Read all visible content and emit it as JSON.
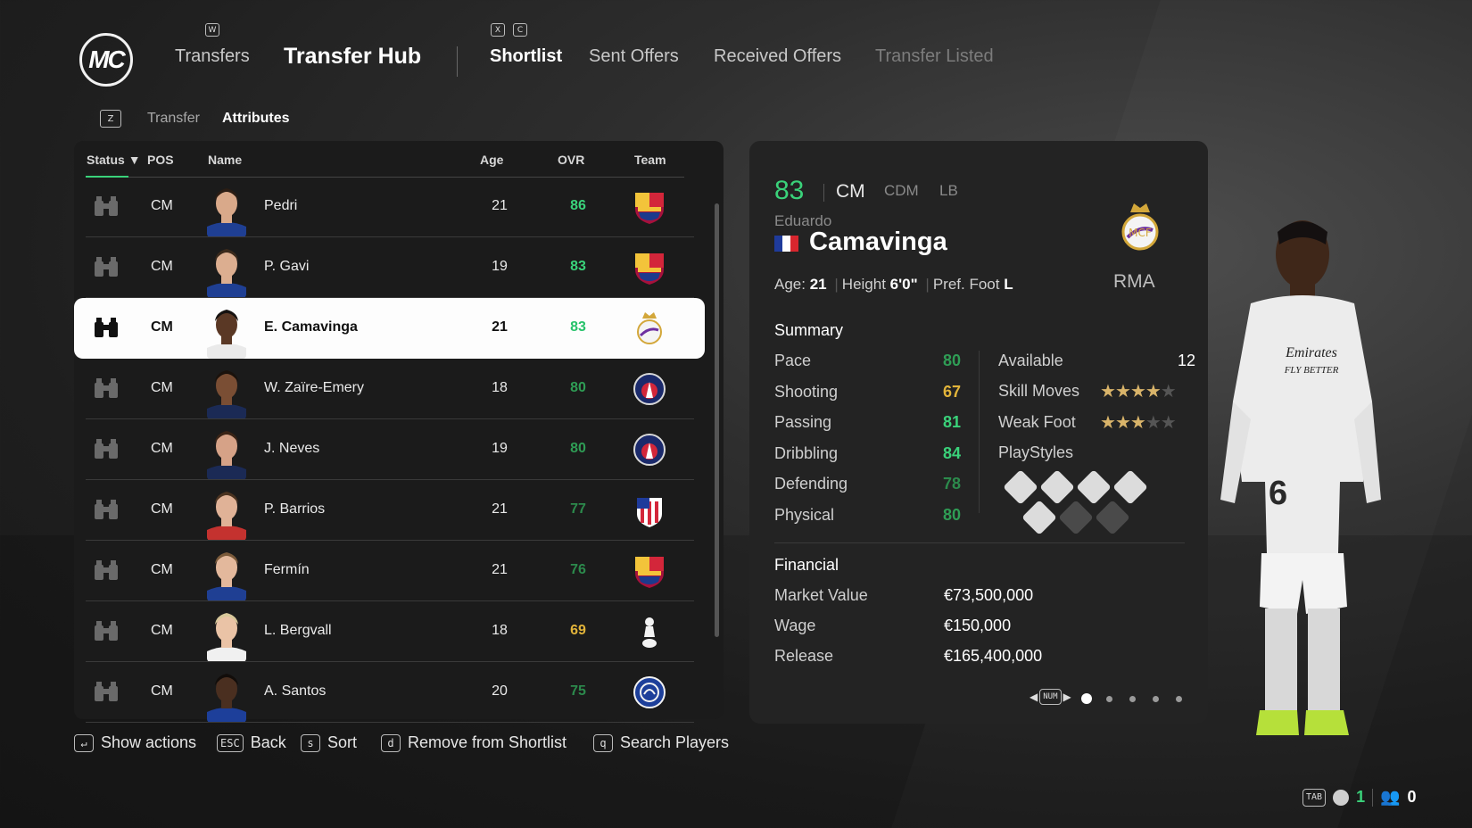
{
  "header": {
    "logo": "MC",
    "nav_transfers": "Transfers",
    "title": "Transfer Hub",
    "key_w": "W",
    "key_x": "X",
    "key_c": "C",
    "tabs": [
      {
        "label": "Shortlist",
        "state": "active"
      },
      {
        "label": "Sent Offers",
        "state": "normal"
      },
      {
        "label": "Received Offers",
        "state": "normal"
      },
      {
        "label": "Transfer Listed",
        "state": "disabled"
      }
    ]
  },
  "subnav": {
    "key": "Z",
    "items": [
      "Transfer",
      "Attributes"
    ],
    "active": "Attributes"
  },
  "table": {
    "columns": {
      "status": "Status",
      "pos": "POS",
      "name": "Name",
      "age": "Age",
      "ovr": "OVR",
      "team": "Team"
    },
    "sort_indicator": "▼",
    "rows": [
      {
        "pos": "CM",
        "name": "Pedri",
        "age": "21",
        "ovr": "86",
        "ovr_color": "#3ad27a",
        "team": "barcelona-crest",
        "skin": "#d9a98a",
        "hair": "#2b1d14",
        "shirt": "#1f3f93"
      },
      {
        "pos": "CM",
        "name": "P. Gavi",
        "age": "19",
        "ovr": "83",
        "ovr_color": "#3ad27a",
        "team": "barcelona-crest",
        "skin": "#dcae90",
        "hair": "#3b2a1c",
        "shirt": "#1f3f93"
      },
      {
        "pos": "CM",
        "name": "E. Camavinga",
        "age": "21",
        "ovr": "83",
        "ovr_color": "#26c26a",
        "team": "real-madrid-crest",
        "skin": "#5a3825",
        "hair": "#161210",
        "shirt": "#eaeaea",
        "selected": true
      },
      {
        "pos": "CM",
        "name": "W. Zaïre-Emery",
        "age": "18",
        "ovr": "80",
        "ovr_color": "#2f9d55",
        "team": "psg-crest",
        "skin": "#7a4e34",
        "hair": "#1a120c",
        "shirt": "#1b2a55"
      },
      {
        "pos": "CM",
        "name": "J. Neves",
        "age": "19",
        "ovr": "80",
        "ovr_color": "#2f9d55",
        "team": "psg-crest",
        "skin": "#d6a287",
        "hair": "#3a2416",
        "shirt": "#1b2a55"
      },
      {
        "pos": "CM",
        "name": "P. Barrios",
        "age": "21",
        "ovr": "77",
        "ovr_color": "#2c8a4c",
        "team": "atletico-crest",
        "skin": "#e0b297",
        "hair": "#4b3320",
        "shirt": "#c4322f"
      },
      {
        "pos": "CM",
        "name": "Fermín",
        "age": "21",
        "ovr": "76",
        "ovr_color": "#2c8a4c",
        "team": "barcelona-crest",
        "skin": "#e3b89c",
        "hair": "#7a5a3a",
        "shirt": "#1f3f93"
      },
      {
        "pos": "CM",
        "name": "L. Bergvall",
        "age": "18",
        "ovr": "69",
        "ovr_color": "#e2b43a",
        "team": "tottenham-crest",
        "skin": "#eac3a6",
        "hair": "#d8c89a",
        "shirt": "#f0f0f0"
      },
      {
        "pos": "CM",
        "name": "A. Santos",
        "age": "20",
        "ovr": "75",
        "ovr_color": "#2c8a4c",
        "team": "chelsea-crest",
        "skin": "#4a2f20",
        "hair": "#120d0a",
        "shirt": "#1d3f9a"
      }
    ]
  },
  "footer_actions": [
    {
      "key": "↵",
      "label": "Show actions"
    },
    {
      "key": "ESC",
      "label": "Back"
    },
    {
      "key": "s",
      "label": "Sort"
    },
    {
      "key": "d",
      "label": "Remove from Shortlist"
    },
    {
      "key": "q",
      "label": "Search Players"
    }
  ],
  "detail": {
    "ovr": "83",
    "pos_primary": "CM",
    "pos_alt1": "CDM",
    "pos_alt2": "LB",
    "first_name": "Eduardo",
    "last_name": "Camavinga",
    "nation": "france-flag",
    "age_label": "Age:",
    "age": "21",
    "height_label": "Height",
    "height": "6'0\"",
    "foot_label": "Pref. Foot",
    "foot": "L",
    "club": "RMA",
    "summary_title": "Summary",
    "stats": [
      {
        "label": "Pace",
        "value": "80",
        "color": "#2f9d55"
      },
      {
        "label": "Shooting",
        "value": "67",
        "color": "#e2b43a"
      },
      {
        "label": "Passing",
        "value": "81",
        "color": "#3ad27a"
      },
      {
        "label": "Dribbling",
        "value": "84",
        "color": "#3ad27a"
      },
      {
        "label": "Defending",
        "value": "78",
        "color": "#2c8a4c"
      },
      {
        "label": "Physical",
        "value": "80",
        "color": "#2f9d55"
      }
    ],
    "available_label": "Available",
    "available": "12",
    "skill_moves_label": "Skill Moves",
    "skill_moves": 4,
    "weak_foot_label": "Weak Foot",
    "weak_foot": 3,
    "playstyles_label": "PlayStyles",
    "financial_title": "Financial",
    "market_value_label": "Market Value",
    "market_value": "€73,500,000",
    "wage_label": "Wage",
    "wage": "€150,000",
    "release_label": "Release",
    "release": "€165,400,000",
    "pager_key": "NUM",
    "pages": 5,
    "page_current": 1
  },
  "status_bar": {
    "key": "TAB",
    "count_a": "1",
    "count_b": "0"
  },
  "colors": {
    "accent_green": "#3ad27a",
    "star_gold": "#d9b46a"
  }
}
